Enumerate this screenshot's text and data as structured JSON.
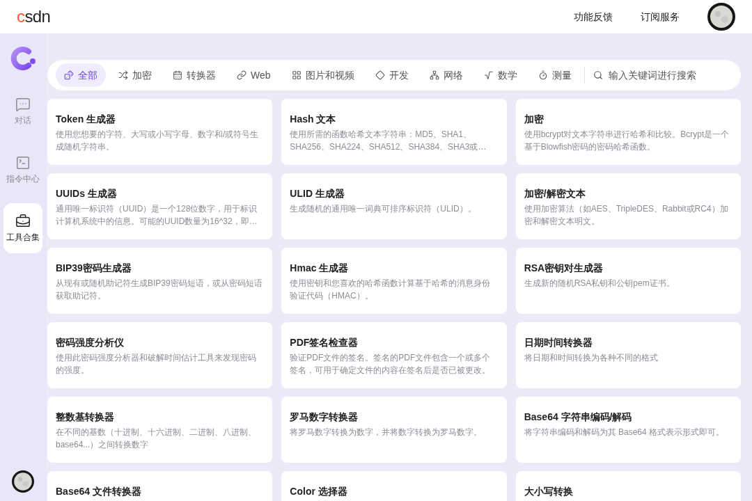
{
  "logo": "csdn",
  "header_links": [
    "功能反馈",
    "订阅服务"
  ],
  "sidebar": {
    "items": [
      {
        "label": "对话",
        "selected": false
      },
      {
        "label": "指令中心",
        "selected": false
      },
      {
        "label": "工具合集",
        "selected": true
      }
    ]
  },
  "filters": [
    {
      "label": "全部",
      "selected": true
    },
    {
      "label": "加密",
      "selected": false
    },
    {
      "label": "转换器",
      "selected": false
    },
    {
      "label": "Web",
      "selected": false
    },
    {
      "label": "图片和视频",
      "selected": false
    },
    {
      "label": "开发",
      "selected": false
    },
    {
      "label": "网络",
      "selected": false
    },
    {
      "label": "数学",
      "selected": false
    },
    {
      "label": "测量",
      "selected": false
    }
  ],
  "search": {
    "placeholder": "输入关键词进行搜索"
  },
  "tools": [
    {
      "title": "Token 生成器",
      "description": "使用您想要的字符、大写或小写字母、数字和/或符号生成随机字符串。"
    },
    {
      "title": "Hash 文本",
      "description": "使用所需的函数哈希文本字符串：MD5、SHA1、SHA256、SHA224、SHA512、SHA384、SHA3或…"
    },
    {
      "title": "加密",
      "description": "使用bcrypt对文本字符串进行哈希和比较。Bcrypt是一个基于Blowfish密码的密码哈希函数。"
    },
    {
      "title": "UUIDs 生成器",
      "description": "通用唯一标识符（UUID）是一个128位数字，用于标识计算机系统中的信息。可能的UUID数量为16^32，即…"
    },
    {
      "title": "ULID 生成器",
      "description": "生成随机的通用唯一词典可排序标识符（ULID）。"
    },
    {
      "title": "加密/解密文本",
      "description": "使用加密算法（如AES、TripleDES、Rabbit或RC4）加密和解密文本明文。"
    },
    {
      "title": "BIP39密码生成器",
      "description": "从现有或随机助记符生成BIP39密码短语，或从密码短语获取助记符。"
    },
    {
      "title": "Hmac 生成器",
      "description": "使用密钥和您喜欢的哈希函数计算基于哈希的消息身份验证代码（HMAC）。"
    },
    {
      "title": "RSA密钥对生成器",
      "description": "生成新的随机RSA私钥和公钥pem证书。"
    },
    {
      "title": "密码强度分析仪",
      "description": "使用此密码强度分析器和破解时间估计工具来发现密码的强度。"
    },
    {
      "title": "PDF签名检查器",
      "description": "验证PDF文件的签名。签名的PDF文件包含一个或多个签名，可用于确定文件的内容在签名后是否已被更改。"
    },
    {
      "title": "日期时间转换器",
      "description": "将日期和时间转换为各种不同的格式"
    },
    {
      "title": "整数基转换器",
      "description": "在不同的基数（十进制、十六进制、二进制、八进制、base64...）之间转换数字"
    },
    {
      "title": "罗马数字转换器",
      "description": "将罗马数字转换为数字，并将数字转换为罗马数字。"
    },
    {
      "title": "Base64 字符串编码/解码",
      "description": "将字符串编码和解码为其 Base64 格式表示形式即可。"
    },
    {
      "title": "Base64 文件转换器"
    },
    {
      "title": "Color 选择器"
    },
    {
      "title": "大小写转换"
    }
  ]
}
